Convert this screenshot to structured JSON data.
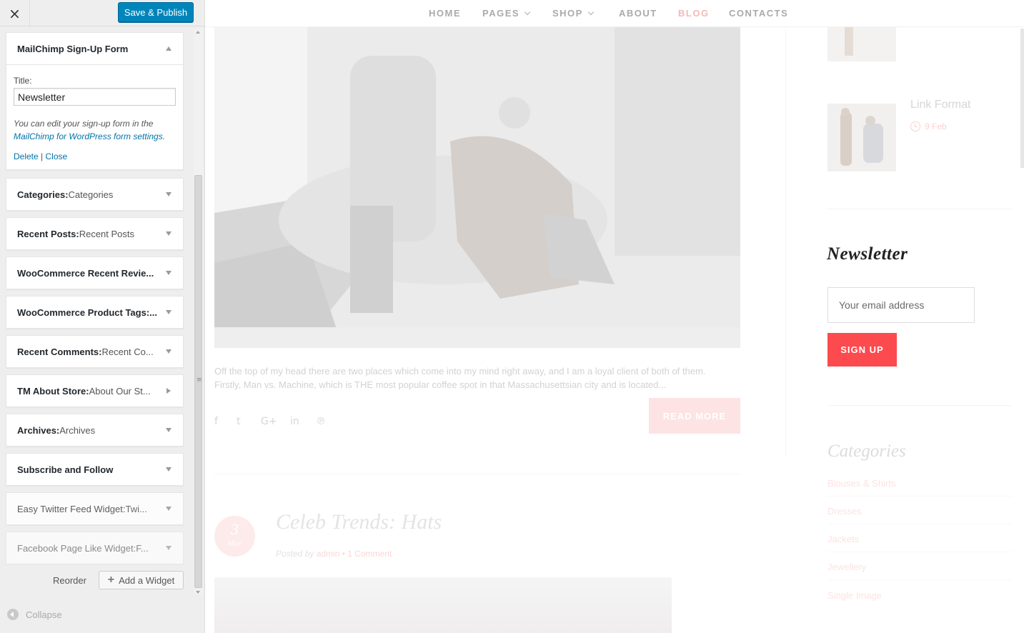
{
  "customizer": {
    "close_label": "×",
    "save_publish_label": "Save & Publish",
    "mailchimp_widget": {
      "title": "MailChimp Sign-Up Form",
      "title_label": "Title:",
      "title_value": "Newsletter",
      "note_text": "You can edit your sign-up form in the ",
      "note_link": "MailChimp for WordPress form settings",
      "note_end": ".",
      "delete_label": "Delete",
      "separator": " | ",
      "close_label": "Close"
    },
    "widgets": [
      {
        "title": "Categories:",
        "sub": " Categories"
      },
      {
        "title": "Recent Posts:",
        "sub": " Recent Posts"
      },
      {
        "title": "WooCommerce Recent Revie...",
        "sub": ""
      },
      {
        "title": "WooCommerce Product Tags:...",
        "sub": ""
      },
      {
        "title": "Recent Comments:",
        "sub": " Recent Co..."
      },
      {
        "title": "TM About Store:",
        "sub": " About Our St..."
      },
      {
        "title": "Archives:",
        "sub": " Archives"
      },
      {
        "title": "Subscribe and Follow",
        "sub": ""
      },
      {
        "title": "Easy Twitter Feed Widget:",
        "sub": " Twi..."
      },
      {
        "title": "Facebook Page Like Widget:",
        "sub": " F..."
      }
    ],
    "reorder_label": "Reorder",
    "add_widget_label": "Add a Widget",
    "collapse_label": "Collapse"
  },
  "preview": {
    "nav": [
      {
        "label": "HOME"
      },
      {
        "label": "PAGES"
      },
      {
        "label": "SHOP"
      },
      {
        "label": "ABOUT"
      },
      {
        "label": "BLOG"
      },
      {
        "label": "CONTACTS"
      }
    ],
    "post": {
      "excerpt_line1": "Off the top of my head there are two places which come into my mind right away, and I am a loyal client of both of them.",
      "excerpt_line2": "Firstly, Man vs. Machine, which is THE most popular coffee spot in that Massachusettsian city and is located...",
      "read_more_label": "READ MORE",
      "social_icons": [
        "facebook-icon",
        "twitter-icon",
        "google-plus-icon",
        "linkedin-icon",
        "pinterest-icon"
      ]
    },
    "post2": {
      "day": "3",
      "month": "Mar",
      "title": "Celeb Trends: Hats",
      "posted_by": "Posted by ",
      "author": "admin",
      "bullet": " • ",
      "comments": "1 Comment"
    },
    "sidebar": {
      "link_format_title": "Link Format",
      "link_format_date": "9 Feb",
      "newsletter_heading": "Newsletter",
      "email_placeholder": "Your email address",
      "signup_label": "SIGN UP",
      "categories_heading": "Categories",
      "categories": [
        "Blouses & Shirts",
        "Dresses",
        "Jackets",
        "Jewellery",
        "Single Image"
      ]
    }
  },
  "colors": {
    "accent_blue": "#0085ba",
    "signup_red": "#fc4a4e",
    "blog_pink": "#f7b8b8"
  }
}
